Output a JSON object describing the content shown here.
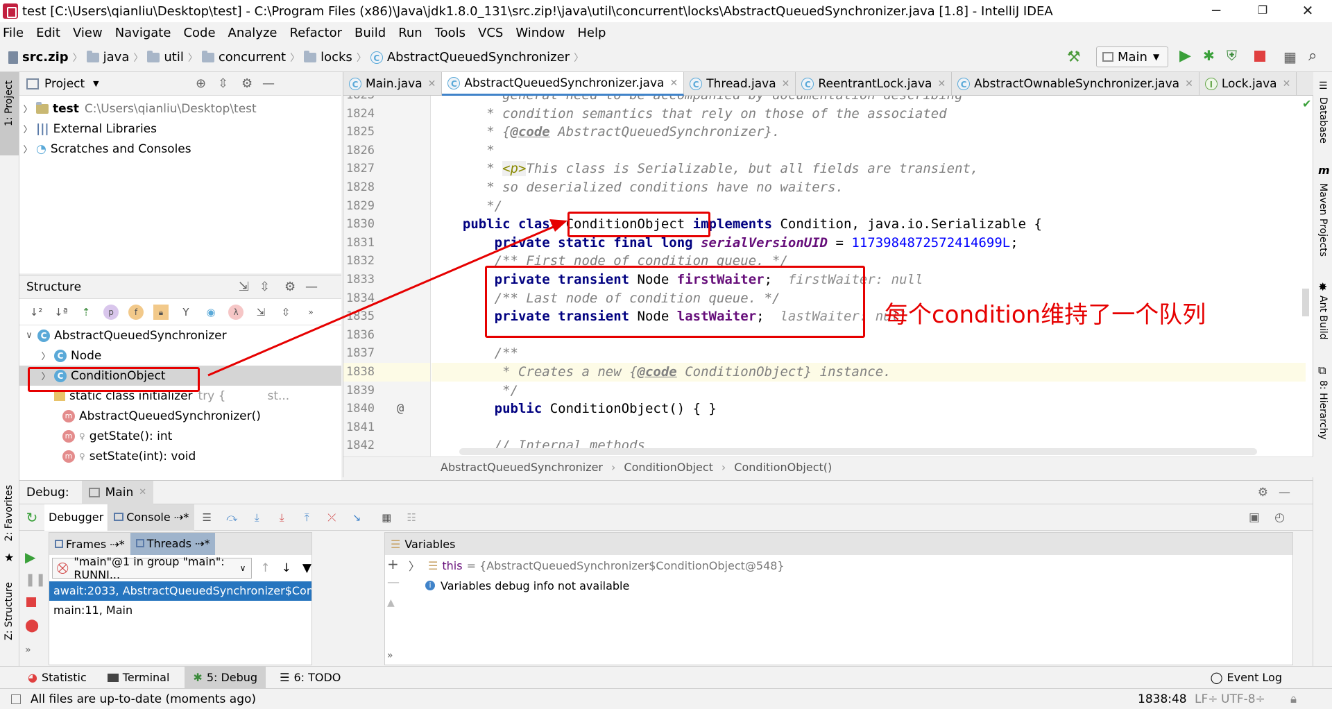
{
  "window": {
    "title": "test [C:\\Users\\qianliu\\Desktop\\test] - C:\\Program Files (x86)\\Java\\jdk1.8.0_131\\src.zip!\\java\\util\\concurrent\\locks\\AbstractQueuedSynchronizer.java [1.8] - IntelliJ IDEA"
  },
  "menu": [
    "File",
    "Edit",
    "View",
    "Navigate",
    "Code",
    "Analyze",
    "Refactor",
    "Build",
    "Run",
    "Tools",
    "VCS",
    "Window",
    "Help"
  ],
  "nav": {
    "crumbs": [
      "src.zip",
      "java",
      "util",
      "concurrent",
      "locks",
      "AbstractQueuedSynchronizer"
    ],
    "run_config": "Main"
  },
  "left_strip": {
    "project": "1: Project",
    "favorites": "2: Favorites",
    "structure": "Z: Structure"
  },
  "right_strip": {
    "database": "Database",
    "maven": "Maven Projects",
    "ant": "Ant Build",
    "hierarchy": "8: Hierarchy"
  },
  "project_panel": {
    "title": "Project",
    "items": [
      {
        "name": "test",
        "path": "C:\\Users\\qianliu\\Desktop\\test"
      },
      {
        "name": "External Libraries",
        "path": ""
      },
      {
        "name": "Scratches and Consoles",
        "path": ""
      }
    ]
  },
  "structure_panel": {
    "title": "Structure",
    "root": "AbstractQueuedSynchronizer",
    "items": [
      {
        "label": "Node",
        "extra": ""
      },
      {
        "label": "ConditionObject",
        "extra": ""
      },
      {
        "label": "static class initializer",
        "extra": "try {",
        "extra2": "st..."
      },
      {
        "label": "AbstractQueuedSynchronizer()",
        "extra": ""
      },
      {
        "label": "getState(): int",
        "extra": ""
      },
      {
        "label": "setState(int): void",
        "extra": ""
      }
    ]
  },
  "tabs": [
    "Main.java",
    "AbstractQueuedSynchronizer.java",
    "Thread.java",
    "ReentrantLock.java",
    "AbstractOwnableSynchronizer.java",
    "Lock.java"
  ],
  "editor": {
    "line_numbers": [
      "1823",
      "1824",
      "1825",
      "1826",
      "1827",
      "1828",
      "1829",
      "1830",
      "1831",
      "1832",
      "1833",
      "1834",
      "1835",
      "1836",
      "1837",
      "1838",
      "1839",
      "1840",
      "1841",
      "1842"
    ],
    "l1823": "     * general need to be accompanied by documentation describing",
    "l1824": "     * condition semantics that rely on those of the associated",
    "l1825_a": "     * {",
    "l1825_tag": "@code",
    "l1825_b": " AbstractQueuedSynchronizer}.",
    "l1826": "     *",
    "l1827_a": "     * ",
    "l1827_tag": "<p>",
    "l1827_b": "This class is Serializable, but all fields are transient,",
    "l1828": "     * so deserialized conditions have no waiters.",
    "l1829": "     */",
    "l1830_kw": "public class ",
    "l1830_name": "ConditionObject",
    "l1830_impl": " implements ",
    "l1830_rest": "Condition, java.io.Serializable {",
    "l1831_kw": "private static final long ",
    "l1831_f": "serialVersionUID",
    "l1831_eq": " = ",
    "l1831_num": "1173984872572414699L",
    "l1831_end": ";",
    "l1832": "/** First node of condition queue. */",
    "l1833_kw": "private transient ",
    "l1833_t": "Node ",
    "l1833_f": "firstWaiter",
    "l1833_end": ";",
    "l1833_hint": "firstWaiter: null",
    "l1834": "/** Last node of condition queue. */",
    "l1835_kw": "private transient ",
    "l1835_t": "Node ",
    "l1835_f": "lastWaiter",
    "l1835_end": ";",
    "l1835_hint": "lastWaiter: null",
    "l1837": "/**",
    "l1838_a": " * Creates a new {",
    "l1838_tag": "@code",
    "l1838_b": " ConditionObject} instance.",
    "l1839": " */",
    "l1840_kw": "public ",
    "l1840_rest": "ConditionObject() { }",
    "l1842": "// Internal methods",
    "annotation": "每个condition维持了一个队列",
    "gutter_at": "@"
  },
  "editor_breadcrumb": [
    "AbstractQueuedSynchronizer",
    "ConditionObject",
    "ConditionObject()"
  ],
  "debug": {
    "label": "Debug:",
    "session": "Main",
    "tab_debugger": "Debugger",
    "tab_console": "Console",
    "frames": "Frames",
    "threads": "Threads",
    "thread_select": "\"main\"@1 in group \"main\": RUNNI...",
    "frame_list": [
      "await:2033, AbstractQueuedSynchronizer$ConditionObject",
      "main:11, Main"
    ],
    "variables_title": "Variables",
    "var_name": "this",
    "var_value": "= {AbstractQueuedSynchronizer$ConditionObject@548}",
    "var_info": "Variables debug info not available"
  },
  "bottom_tools": {
    "statistic": "Statistic",
    "terminal": "Terminal",
    "debug": "5: Debug",
    "todo": "6: TODO",
    "event_log": "Event Log"
  },
  "status": {
    "message": "All files are up-to-date (moments ago)",
    "position": "1838:48",
    "lf": "LF÷",
    "encoding": "UTF-8÷"
  },
  "colors": {
    "accent": "#4083c9",
    "annotation": "#e60000",
    "selection": "#2675bf",
    "keyword": "#000080"
  }
}
